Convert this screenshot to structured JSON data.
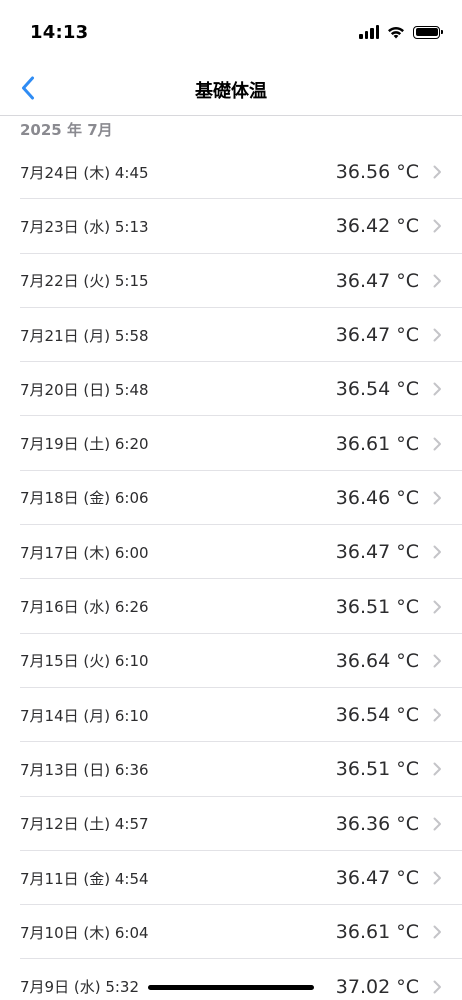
{
  "status_bar": {
    "time": "14:13"
  },
  "nav": {
    "title": "基礎体温",
    "back_icon": "chevron-left-icon"
  },
  "section": {
    "header": "2025 年 7月"
  },
  "rows": [
    {
      "date": "7月24日 (木) 4:45",
      "temp": "36.56 °C"
    },
    {
      "date": "7月23日 (水) 5:13",
      "temp": "36.42 °C"
    },
    {
      "date": "7月22日 (火) 5:15",
      "temp": "36.47 °C"
    },
    {
      "date": "7月21日 (月) 5:58",
      "temp": "36.47 °C"
    },
    {
      "date": "7月20日 (日) 5:48",
      "temp": "36.54 °C"
    },
    {
      "date": "7月19日 (土) 6:20",
      "temp": "36.61 °C"
    },
    {
      "date": "7月18日 (金) 6:06",
      "temp": "36.46 °C"
    },
    {
      "date": "7月17日 (木) 6:00",
      "temp": "36.47 °C"
    },
    {
      "date": "7月16日 (水) 6:26",
      "temp": "36.51 °C"
    },
    {
      "date": "7月15日 (火) 6:10",
      "temp": "36.64 °C"
    },
    {
      "date": "7月14日 (月) 6:10",
      "temp": "36.54 °C"
    },
    {
      "date": "7月13日 (日) 6:36",
      "temp": "36.51 °C"
    },
    {
      "date": "7月12日 (土) 4:57",
      "temp": "36.36 °C"
    },
    {
      "date": "7月11日 (金) 4:54",
      "temp": "36.47 °C"
    },
    {
      "date": "7月10日 (木) 6:04",
      "temp": "36.61 °C"
    },
    {
      "date": "7月9日 (水) 5:32",
      "temp": "37.02 °C"
    }
  ],
  "colors": {
    "accent": "#2f8cf4",
    "chevron": "#c4c4c8",
    "section_header": "#8a8a90"
  }
}
